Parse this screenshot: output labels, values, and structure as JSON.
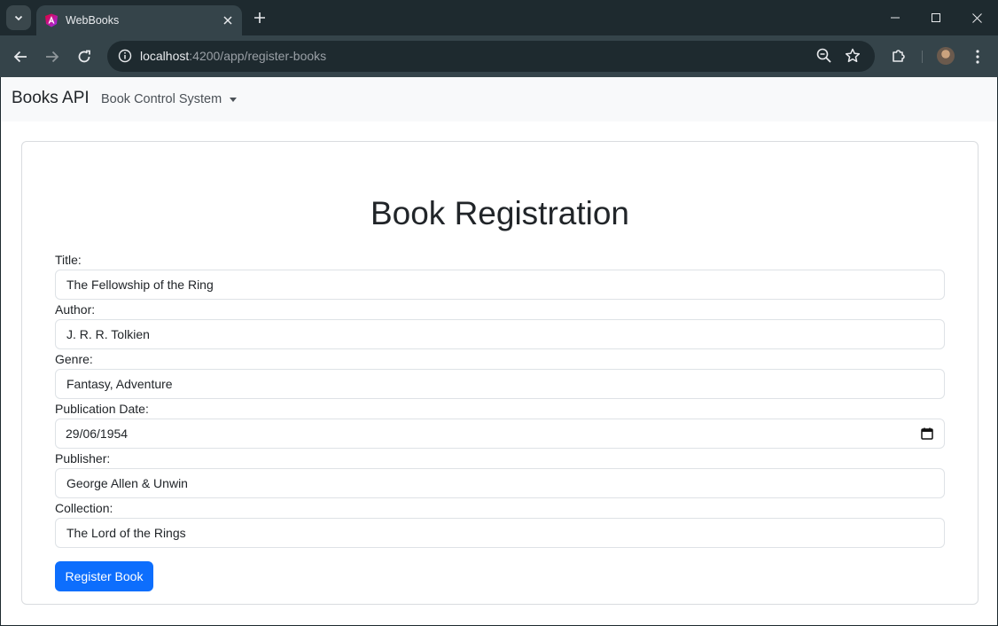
{
  "browser": {
    "tab_title": "WebBooks",
    "url_host": "localhost",
    "url_rest": ":4200/app/register-books"
  },
  "navbar": {
    "brand": "Books API",
    "dropdown_label": "Book Control System"
  },
  "form": {
    "heading": "Book Registration",
    "fields": [
      {
        "label": "Title:",
        "value": "The Fellowship of the Ring"
      },
      {
        "label": "Author:",
        "value": "J. R. R. Tolkien"
      },
      {
        "label": "Genre:",
        "value": "Fantasy, Adventure"
      },
      {
        "label": "Publication Date:",
        "value": "29/06/1954"
      },
      {
        "label": "Publisher:",
        "value": "George Allen & Unwin"
      },
      {
        "label": "Collection:",
        "value": "The Lord of the Rings"
      }
    ],
    "submit_label": "Register Book"
  },
  "colors": {
    "primary": "#0d6efd",
    "navbar_bg": "#f8f9fa",
    "chrome_bg": "#35444a"
  }
}
